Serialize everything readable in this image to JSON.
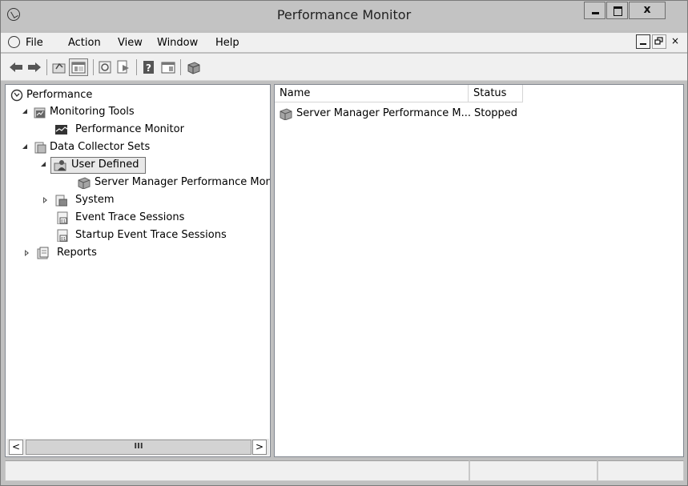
{
  "window": {
    "title": "Performance Monitor"
  },
  "menu": {
    "items": [
      "File",
      "Action",
      "View",
      "Window",
      "Help"
    ]
  },
  "tree": {
    "nodes": [
      {
        "label": "Performance",
        "icon": "performance-app-icon",
        "level": 0,
        "expand": "none"
      },
      {
        "label": "Monitoring Tools",
        "icon": "monitoring-tools-icon",
        "level": 1,
        "expand": "expanded"
      },
      {
        "label": "Performance Monitor",
        "icon": "performance-monitor-icon",
        "level": 2,
        "expand": "none"
      },
      {
        "label": "Data Collector Sets",
        "icon": "data-collector-sets-icon",
        "level": 1,
        "expand": "expanded"
      },
      {
        "label": "User Defined",
        "icon": "user-defined-icon",
        "level": 2,
        "expand": "expanded",
        "selected": true
      },
      {
        "label": "Server Manager Performance Moni",
        "icon": "collector-set-icon",
        "level": 3,
        "expand": "none"
      },
      {
        "label": "System",
        "icon": "system-folder-icon",
        "level": 2,
        "expand": "collapsed"
      },
      {
        "label": "Event Trace Sessions",
        "icon": "event-trace-icon",
        "level": 2,
        "expand": "none"
      },
      {
        "label": "Startup Event Trace Sessions",
        "icon": "event-trace-icon",
        "level": 2,
        "expand": "none"
      },
      {
        "label": "Reports",
        "icon": "reports-icon",
        "level": 1,
        "expand": "collapsed"
      }
    ]
  },
  "hscroll": {
    "left": "<",
    "thumb": "III",
    "right": ">"
  },
  "list": {
    "columns": [
      "Name",
      "Status"
    ],
    "rows": [
      {
        "name": "Server Manager Performance M...",
        "status": "Stopped",
        "icon": "collector-set-icon"
      }
    ]
  },
  "mdi": {
    "close": "×"
  },
  "colors": {
    "titlebar": "#c3c3c3",
    "selection": "#e8e8e8",
    "pane_border": "#828790"
  }
}
